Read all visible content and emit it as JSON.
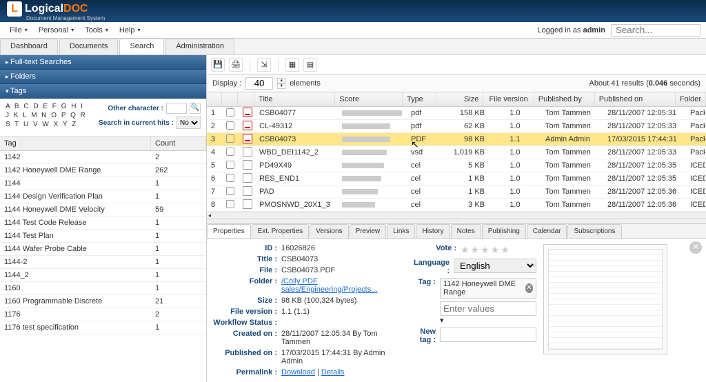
{
  "brand": {
    "name_left": "Logical",
    "name_right": "DOC",
    "tagline": "Document Management System"
  },
  "menus": [
    "File",
    "Personal",
    "Tools",
    "Help"
  ],
  "logged_in_prefix": "Logged in as ",
  "logged_in_user": "admin",
  "search_placeholder": "Search...",
  "main_tabs": [
    "Dashboard",
    "Documents",
    "Search",
    "Administration"
  ],
  "active_main_tab": 2,
  "accordion": {
    "fulltext": "Full-text Searches",
    "folders": "Folders",
    "tags": "Tags"
  },
  "alpha_rows": [
    "A B C D E F G H I",
    "J K L M N O P Q R",
    "S T U V W X Y Z"
  ],
  "other_char_label": "Other character :",
  "search_hits_label": "Search in current hits :",
  "search_hits_value": "No",
  "tag_header": {
    "tag": "Tag",
    "count": "Count"
  },
  "tags": [
    {
      "tag": "1142",
      "count": "2"
    },
    {
      "tag": "1142 Honeywell DME Range",
      "count": "262"
    },
    {
      "tag": "1144",
      "count": "1"
    },
    {
      "tag": "1144 Design Verification Plan",
      "count": "1"
    },
    {
      "tag": "1144 Honeywell DME Velocity",
      "count": "59"
    },
    {
      "tag": "1144 Test Code Release",
      "count": "1"
    },
    {
      "tag": "1144 Test Plan",
      "count": "1"
    },
    {
      "tag": "1144 Wafer Probe Cable",
      "count": "1"
    },
    {
      "tag": "1144-2",
      "count": "1"
    },
    {
      "tag": "1144_2",
      "count": "1"
    },
    {
      "tag": "1160",
      "count": "1"
    },
    {
      "tag": "1160 Programmable Discrete",
      "count": "21"
    },
    {
      "tag": "1176",
      "count": "2"
    },
    {
      "tag": "1176 test specification",
      "count": "1"
    }
  ],
  "display_label": "Display :",
  "display_value": "40",
  "display_suffix": "elements",
  "results_text_prefix": "About 41 results (",
  "results_seconds": "0.046",
  "results_text_suffix": " seconds)",
  "grid_headers": {
    "title": "Title",
    "score": "Score",
    "type": "Type",
    "size": "Size",
    "fv": "File version",
    "pub": "Published by",
    "pon": "Published on",
    "folder": "Folder"
  },
  "rows": [
    {
      "n": "1",
      "ico": "pdf",
      "title": "CSB04077",
      "score": 100,
      "type": "pdf",
      "size": "158 KB",
      "fv": "1.0",
      "pub": "Tom Tammen",
      "pon": "28/11/2007 12:05:31",
      "folder": "Package"
    },
    {
      "n": "2",
      "ico": "pdf",
      "title": "CL-49312",
      "score": 80,
      "type": "pdf",
      "size": "62 KB",
      "fv": "1.0",
      "pub": "Tom Tammen",
      "pon": "28/11/2007 12:05:33",
      "folder": "Package"
    },
    {
      "n": "3",
      "ico": "pdf",
      "title": "CSB04073",
      "score": 80,
      "type": "PDF",
      "size": "98 KB",
      "fv": "1.1",
      "pub": "Admin Admin",
      "pon": "17/03/2015 17:44:31",
      "folder": "Package",
      "selected": true
    },
    {
      "n": "4",
      "ico": "doc",
      "title": "WBD_DEI1142_2",
      "score": 75,
      "type": "vsd",
      "size": "1,019 KB",
      "fv": "1.0",
      "pub": "Tom Tammen",
      "pon": "28/11/2007 12:05:33",
      "folder": "Package"
    },
    {
      "n": "5",
      "ico": "doc",
      "title": "PD49X49",
      "score": 70,
      "type": "cel",
      "size": "5 KB",
      "fv": "1.0",
      "pub": "Tom Tammen",
      "pon": "28/11/2007 12:05:35",
      "folder": "ICED"
    },
    {
      "n": "6",
      "ico": "doc",
      "title": "RES_END1",
      "score": 65,
      "type": "cel",
      "size": "1 KB",
      "fv": "1.0",
      "pub": "Tom Tammen",
      "pon": "28/11/2007 12:05:35",
      "folder": "ICED"
    },
    {
      "n": "7",
      "ico": "doc",
      "title": "PAD",
      "score": 60,
      "type": "cel",
      "size": "1 KB",
      "fv": "1.0",
      "pub": "Tom Tammen",
      "pon": "28/11/2007 12:05:36",
      "folder": "ICED"
    },
    {
      "n": "8",
      "ico": "doc",
      "title": "PMOSNWD_20X1_3",
      "score": 55,
      "type": "cel",
      "size": "3 KB",
      "fv": "1.0",
      "pub": "Tom Tammen",
      "pon": "28/11/2007 12:05:36",
      "folder": "ICED"
    }
  ],
  "detail_tabs": [
    "Properties",
    "Ext. Properties",
    "Versions",
    "Preview",
    "Links",
    "History",
    "Notes",
    "Publishing",
    "Calendar",
    "Subscriptions"
  ],
  "active_detail_tab": 0,
  "props": {
    "id_label": "ID",
    "id": "16026826",
    "title_label": "Title",
    "title": "CSB04073",
    "file_label": "File",
    "file": "CSB04073.PDF",
    "folder_label": "Folder",
    "folder": "/Colly PDF sales/Engineering/Projects...",
    "size_label": "Size",
    "size": "98 KB (100,324 bytes)",
    "fv_label": "File version",
    "fv": "1.1 (1.1)",
    "wf_label": "Workflow Status",
    "wf": "",
    "created_label": "Created on",
    "created": "28/11/2007 12:05:34 By Tom Tammen",
    "published_label": "Published on",
    "published": "17/03/2015 17:44:31 By Admin Admin",
    "permalink_label": "Permalink",
    "download": "Download",
    "details": "Details",
    "vote_label": "Vote",
    "language_label": "Language",
    "language": "English",
    "tag_label": "Tag",
    "tag_chip": "1142 Honeywell DME Range",
    "tag_placeholder": "Enter values",
    "newtag_label": "New tag"
  }
}
